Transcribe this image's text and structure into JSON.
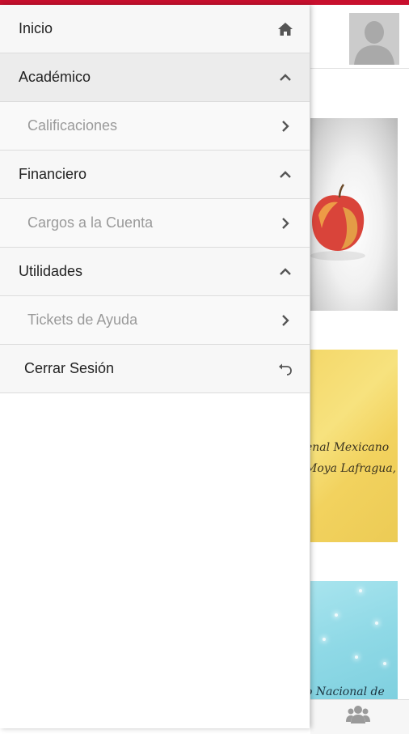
{
  "menu": {
    "inicio": {
      "label": "Inicio",
      "icon": "home-icon"
    },
    "academico": {
      "label": "Académico",
      "icon": "chevron-up-icon"
    },
    "calificaciones": {
      "label": "Calificaciones",
      "icon": "chevron-right-icon"
    },
    "financiero": {
      "label": "Financiero",
      "icon": "chevron-up-icon"
    },
    "cargos": {
      "label": "Cargos a la Cuenta",
      "icon": "chevron-right-icon"
    },
    "utilidades": {
      "label": "Utilidades",
      "icon": "chevron-up-icon"
    },
    "tickets": {
      "label": "Tickets de Ayuda",
      "icon": "chevron-right-icon"
    },
    "cerrar": {
      "label": "Cerrar Sesión",
      "icon": "undo-icon"
    }
  },
  "background": {
    "avatar": "user-silhouette-icon",
    "card_yellow": {
      "line1": "enal Mexicano",
      "line2": "Moya Lafragua,"
    },
    "card_blue": {
      "line1": "o Nacional de"
    },
    "bottom_icon": "users-icon"
  },
  "colors": {
    "accent": "#c8102e",
    "drawer_bg": "#f7f7f7",
    "expanded_bg": "#ececec",
    "sub_text": "#9a9a9a",
    "icon": "#555555"
  }
}
